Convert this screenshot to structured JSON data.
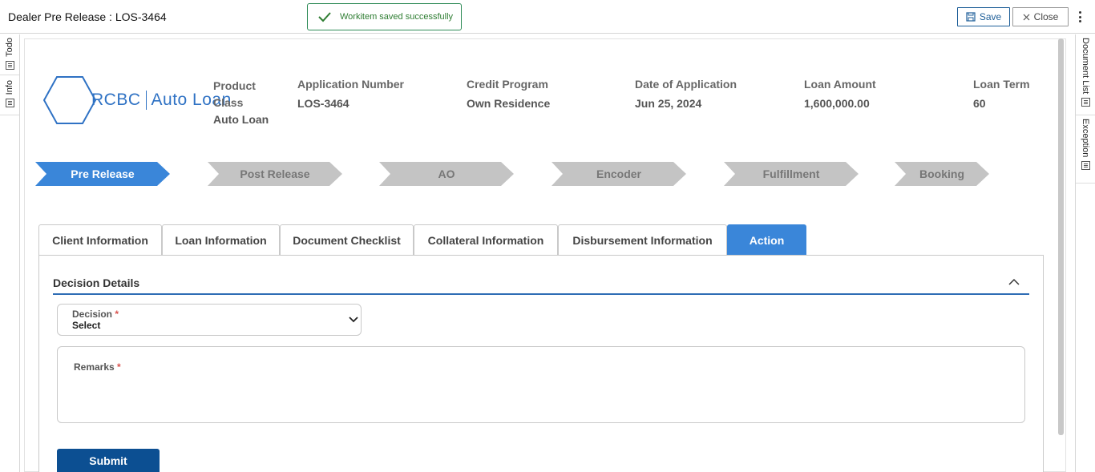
{
  "header": {
    "title": "Dealer Pre Release : LOS-3464",
    "toast_message": "Workitem saved successfully",
    "save_label": "Save",
    "close_label": "Close"
  },
  "left_rail": {
    "items": [
      {
        "label": "Todo",
        "icon": "document-icon"
      },
      {
        "label": "Info",
        "icon": "document-icon"
      }
    ]
  },
  "right_rail": {
    "items": [
      {
        "label": "Document List",
        "icon": "document-icon"
      },
      {
        "label": "Exception",
        "icon": "document-icon"
      }
    ]
  },
  "logo": {
    "brand": "RCBC",
    "product": "Auto Loan",
    "color": "#2f72c4"
  },
  "summary": {
    "product_class_label": "Product Class",
    "product_class_value": "Auto Loan",
    "application_number_label": "Application Number",
    "application_number_value": "LOS-3464",
    "credit_program_label": "Credit Program",
    "credit_program_value": "Own Residence",
    "date_label": "Date of Application",
    "date_value": "Jun 25, 2024",
    "loan_amount_label": "Loan Amount",
    "loan_amount_value": "1,600,000.00",
    "loan_term_label": "Loan Term",
    "loan_term_value": "60"
  },
  "stepper": {
    "steps": [
      "Pre Release",
      "Post Release",
      "AO",
      "Encoder",
      "Fulfillment",
      "Booking"
    ],
    "active_index": 0,
    "active_color": "#3a86d9",
    "inactive_color": "#c4c4c4"
  },
  "tabs": {
    "items": [
      "Client Information",
      "Loan Information",
      "Document Checklist",
      "Collateral Information",
      "Disbursement Information",
      "Action"
    ],
    "active_index": 5
  },
  "decision": {
    "section_title": "Decision Details",
    "decision_label": "Decision",
    "decision_value": "Select",
    "remarks_label": "Remarks",
    "required_marker": "*",
    "submit_label": "Submit"
  }
}
